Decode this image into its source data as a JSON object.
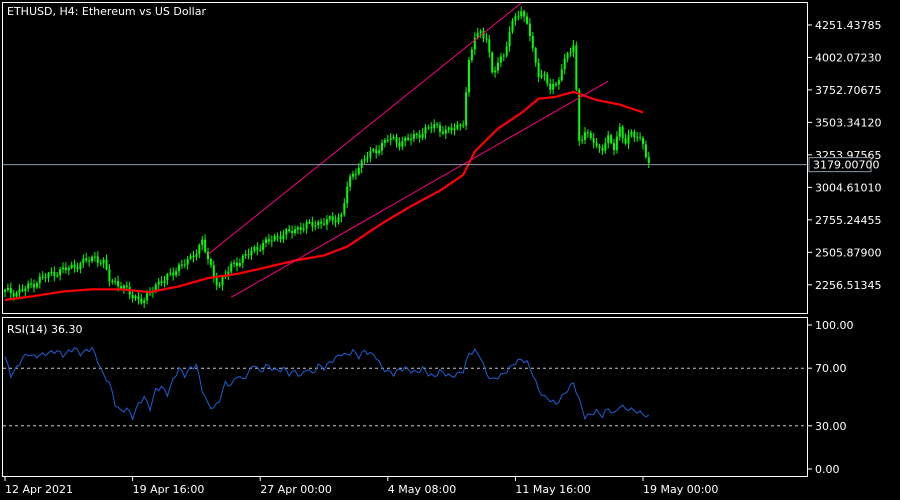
{
  "symbol_line": "ETHUSD, H4:  Ethereum vs US Dollar",
  "price_panel": {
    "y_ticks": [
      {
        "value": 4251.43785,
        "label": "4251.43785"
      },
      {
        "value": 4002.0723,
        "label": "4002.07230"
      },
      {
        "value": 3752.70675,
        "label": "3752.70675"
      },
      {
        "value": 3503.3412,
        "label": "3503.34120"
      },
      {
        "value": 3253.97565,
        "label": "3253.97565"
      },
      {
        "value": 3004.6101,
        "label": "3004.61010"
      },
      {
        "value": 2755.24455,
        "label": "2755.24455"
      },
      {
        "value": 2505.879,
        "label": "2505.87900"
      },
      {
        "value": 2256.51345,
        "label": "2256.51345"
      }
    ],
    "current_price": {
      "value": 3179.007,
      "label": "3179.00700"
    },
    "price_range": [
      2040,
      4420
    ]
  },
  "rsi_panel": {
    "label": "RSI(14) 36.30",
    "y_ticks": [
      {
        "value": 100,
        "label": "100.00"
      },
      {
        "value": 70,
        "label": "70.00"
      },
      {
        "value": 30,
        "label": "30.00"
      },
      {
        "value": 0,
        "label": "0.00"
      }
    ],
    "levels": [
      70,
      30
    ]
  },
  "x_ticks": [
    {
      "index": 0,
      "label": "12 Apr 2021"
    },
    {
      "index": 44,
      "label": "19 Apr 16:00"
    },
    {
      "index": 88,
      "label": "27 Apr 00:00"
    },
    {
      "index": 132,
      "label": "4 May 08:00"
    },
    {
      "index": 176,
      "label": "11 May 16:00"
    },
    {
      "index": 220,
      "label": "19 May 00:00"
    }
  ],
  "colors": {
    "background": "#000000",
    "grid": "#ffffff",
    "candle": "#00ff00",
    "ma": "#ff0000",
    "channel": "#ff0080",
    "rsi": "#1e5fd6",
    "current_line": "#8a9aa8"
  },
  "chart_data": {
    "type": "candlestick",
    "instrument": "ETHUSD",
    "timeframe": "H4",
    "close_anchors": [
      [
        0,
        2205
      ],
      [
        4,
        2195
      ],
      [
        8,
        2240
      ],
      [
        12,
        2300
      ],
      [
        16,
        2340
      ],
      [
        20,
        2370
      ],
      [
        24,
        2400
      ],
      [
        28,
        2440
      ],
      [
        31,
        2470
      ],
      [
        34,
        2420
      ],
      [
        36,
        2300
      ],
      [
        40,
        2250
      ],
      [
        44,
        2170
      ],
      [
        48,
        2130
      ],
      [
        52,
        2260
      ],
      [
        56,
        2310
      ],
      [
        60,
        2400
      ],
      [
        64,
        2450
      ],
      [
        68,
        2590
      ],
      [
        70,
        2450
      ],
      [
        72,
        2310
      ],
      [
        74,
        2260
      ],
      [
        78,
        2400
      ],
      [
        82,
        2460
      ],
      [
        86,
        2530
      ],
      [
        90,
        2580
      ],
      [
        94,
        2630
      ],
      [
        98,
        2660
      ],
      [
        102,
        2700
      ],
      [
        106,
        2720
      ],
      [
        110,
        2740
      ],
      [
        114,
        2760
      ],
      [
        116,
        2790
      ],
      [
        118,
        3010
      ],
      [
        120,
        3100
      ],
      [
        124,
        3230
      ],
      [
        128,
        3290
      ],
      [
        132,
        3380
      ],
      [
        136,
        3350
      ],
      [
        140,
        3380
      ],
      [
        144,
        3430
      ],
      [
        148,
        3480
      ],
      [
        152,
        3430
      ],
      [
        156,
        3470
      ],
      [
        158,
        3510
      ],
      [
        160,
        3950
      ],
      [
        162,
        4170
      ],
      [
        164,
        4200
      ],
      [
        166,
        4150
      ],
      [
        168,
        3870
      ],
      [
        170,
        3970
      ],
      [
        172,
        4030
      ],
      [
        174,
        4180
      ],
      [
        176,
        4330
      ],
      [
        178,
        4350
      ],
      [
        180,
        4280
      ],
      [
        182,
        4040
      ],
      [
        184,
        3880
      ],
      [
        186,
        3860
      ],
      [
        188,
        3760
      ],
      [
        190,
        3780
      ],
      [
        192,
        3930
      ],
      [
        194,
        4030
      ],
      [
        196,
        4080
      ],
      [
        198,
        3380
      ],
      [
        200,
        3420
      ],
      [
        202,
        3390
      ],
      [
        204,
        3300
      ],
      [
        206,
        3320
      ],
      [
        208,
        3380
      ],
      [
        210,
        3300
      ],
      [
        212,
        3460
      ],
      [
        214,
        3360
      ],
      [
        216,
        3410
      ],
      [
        218,
        3390
      ],
      [
        220,
        3350
      ],
      [
        222,
        3179
      ]
    ],
    "ma_anchors": [
      [
        0,
        2140
      ],
      [
        10,
        2170
      ],
      [
        20,
        2205
      ],
      [
        30,
        2222
      ],
      [
        40,
        2222
      ],
      [
        50,
        2200
      ],
      [
        60,
        2245
      ],
      [
        70,
        2308
      ],
      [
        80,
        2340
      ],
      [
        90,
        2390
      ],
      [
        100,
        2443
      ],
      [
        110,
        2482
      ],
      [
        118,
        2550
      ],
      [
        130,
        2728
      ],
      [
        140,
        2860
      ],
      [
        150,
        2980
      ],
      [
        158,
        3100
      ],
      [
        162,
        3280
      ],
      [
        170,
        3456
      ],
      [
        178,
        3575
      ],
      [
        184,
        3685
      ],
      [
        190,
        3700
      ],
      [
        196,
        3738
      ],
      [
        204,
        3675
      ],
      [
        212,
        3640
      ],
      [
        220,
        3580
      ]
    ],
    "channel_lines": [
      {
        "from": [
          70,
          2490
        ],
        "to": [
          178,
          4420
        ]
      },
      {
        "from": [
          78,
          2160
        ],
        "to": [
          208,
          3820
        ]
      }
    ],
    "rsi_anchors": [
      [
        0,
        78
      ],
      [
        2,
        65
      ],
      [
        4,
        70
      ],
      [
        6,
        77
      ],
      [
        8,
        80
      ],
      [
        10,
        78
      ],
      [
        14,
        80
      ],
      [
        18,
        82
      ],
      [
        20,
        79
      ],
      [
        24,
        84
      ],
      [
        26,
        80
      ],
      [
        30,
        84
      ],
      [
        32,
        75
      ],
      [
        34,
        65
      ],
      [
        36,
        60
      ],
      [
        38,
        45
      ],
      [
        40,
        40
      ],
      [
        42,
        42
      ],
      [
        44,
        36
      ],
      [
        46,
        45
      ],
      [
        48,
        50
      ],
      [
        50,
        42
      ],
      [
        52,
        55
      ],
      [
        54,
        57
      ],
      [
        56,
        52
      ],
      [
        58,
        62
      ],
      [
        60,
        70
      ],
      [
        62,
        65
      ],
      [
        64,
        70
      ],
      [
        66,
        72
      ],
      [
        68,
        55
      ],
      [
        70,
        45
      ],
      [
        72,
        42
      ],
      [
        74,
        48
      ],
      [
        76,
        60
      ],
      [
        78,
        58
      ],
      [
        80,
        65
      ],
      [
        82,
        62
      ],
      [
        84,
        67
      ],
      [
        86,
        73
      ],
      [
        88,
        67
      ],
      [
        90,
        72
      ],
      [
        92,
        70
      ],
      [
        94,
        68
      ],
      [
        96,
        70
      ],
      [
        98,
        66
      ],
      [
        100,
        68
      ],
      [
        102,
        64
      ],
      [
        104,
        70
      ],
      [
        106,
        66
      ],
      [
        108,
        72
      ],
      [
        110,
        70
      ],
      [
        112,
        74
      ],
      [
        114,
        77
      ],
      [
        116,
        80
      ],
      [
        118,
        79
      ],
      [
        120,
        82
      ],
      [
        122,
        78
      ],
      [
        124,
        82
      ],
      [
        126,
        80
      ],
      [
        128,
        78
      ],
      [
        130,
        70
      ],
      [
        132,
        68
      ],
      [
        134,
        66
      ],
      [
        136,
        69
      ],
      [
        138,
        70
      ],
      [
        140,
        68
      ],
      [
        142,
        67
      ],
      [
        144,
        70
      ],
      [
        146,
        66
      ],
      [
        148,
        64
      ],
      [
        150,
        68
      ],
      [
        152,
        66
      ],
      [
        154,
        64
      ],
      [
        156,
        66
      ],
      [
        158,
        68
      ],
      [
        160,
        80
      ],
      [
        162,
        82
      ],
      [
        164,
        78
      ],
      [
        166,
        66
      ],
      [
        168,
        62
      ],
      [
        170,
        64
      ],
      [
        172,
        66
      ],
      [
        174,
        70
      ],
      [
        176,
        74
      ],
      [
        178,
        76
      ],
      [
        180,
        74
      ],
      [
        182,
        66
      ],
      [
        184,
        55
      ],
      [
        186,
        50
      ],
      [
        188,
        48
      ],
      [
        190,
        45
      ],
      [
        192,
        50
      ],
      [
        194,
        55
      ],
      [
        196,
        60
      ],
      [
        198,
        48
      ],
      [
        200,
        36
      ],
      [
        202,
        38
      ],
      [
        204,
        40
      ],
      [
        206,
        37
      ],
      [
        208,
        42
      ],
      [
        210,
        38
      ],
      [
        212,
        44
      ],
      [
        214,
        42
      ],
      [
        216,
        41
      ],
      [
        218,
        40
      ],
      [
        220,
        38
      ],
      [
        222,
        36.3
      ]
    ]
  }
}
